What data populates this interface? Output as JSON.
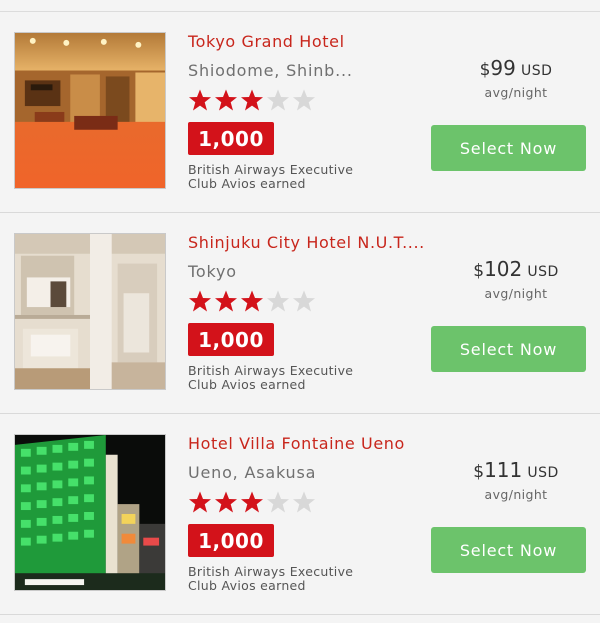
{
  "colors": {
    "name": "#c8261c",
    "badge": "#d3121a",
    "button": "#6cc36b",
    "star_on": "#d3121a",
    "star_off": "#d8d8d8"
  },
  "hotels": [
    {
      "name": "Tokyo Grand Hotel",
      "location": "Shiodome, Shinb...",
      "stars": 3,
      "stars_max": 5,
      "avios": "1,000",
      "avios_note": "British Airways Executive Club Avios earned",
      "currency_symbol": "$",
      "price": "99",
      "currency": "USD",
      "per": "avg/night",
      "button": "Select Now",
      "image": "hotel-lobby-photo"
    },
    {
      "name": "Shinjuku City Hotel N.U.T....",
      "location": "Tokyo",
      "stars": 3,
      "stars_max": 5,
      "avios": "1,000",
      "avios_note": "British Airways Executive Club Avios earned",
      "currency_symbol": "$",
      "price": "102",
      "currency": "USD",
      "per": "avg/night",
      "button": "Select Now",
      "image": "hotel-room-photo"
    },
    {
      "name": "Hotel Villa Fontaine Ueno",
      "location": "Ueno, Asakusa",
      "stars": 3,
      "stars_max": 5,
      "avios": "1,000",
      "avios_note": "British Airways Executive Club Avios earned",
      "currency_symbol": "$",
      "price": "111",
      "currency": "USD",
      "per": "avg/night",
      "button": "Select Now",
      "image": "hotel-exterior-night-photo"
    }
  ]
}
